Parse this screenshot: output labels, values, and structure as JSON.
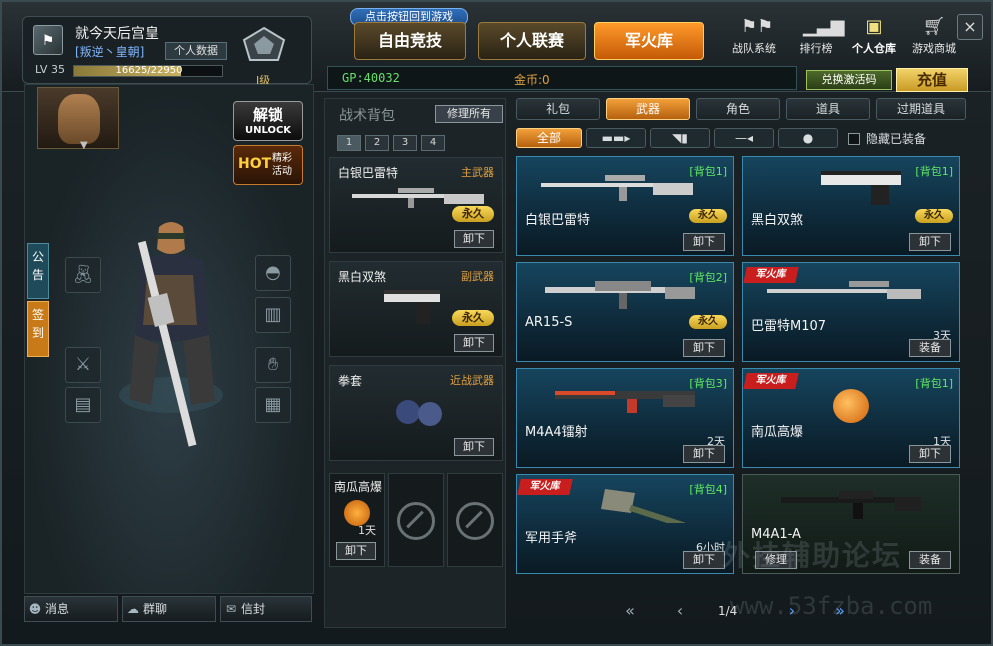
{
  "profile": {
    "name": "就今天后宫皇",
    "clan_tag": "[叛逆丶皇朝]",
    "personal_data": "个人数据",
    "level": "LV 35",
    "xp_text": "16625/22950",
    "xp_fraction": 0.724,
    "rank_label": "I级"
  },
  "top": {
    "home_tip": "点击按钮回到游戏",
    "tabs": [
      "自由竞技",
      "个人联赛",
      "军火库"
    ],
    "nav": [
      {
        "label": "战队系统",
        "icon": "flags-icon"
      },
      {
        "label": "排行榜",
        "icon": "bars-icon"
      },
      {
        "label": "个人仓库",
        "icon": "box-icon"
      },
      {
        "label": "游戏商城",
        "icon": "cart-icon"
      }
    ],
    "close": "×"
  },
  "currency": {
    "gp": "GP:40032",
    "coin": "金币:0",
    "redeem": "兑换激活码",
    "recharge": "充值"
  },
  "left": {
    "unlock_cn": "解锁",
    "unlock_en": "UNLOCK",
    "hot": "HOT",
    "event": "精彩活动",
    "notice": "公告",
    "sign": "签到",
    "bottom": [
      "消息",
      "群聊",
      "信封"
    ]
  },
  "backpack": {
    "title": "战术背包",
    "repair_all": "修理所有",
    "pages": [
      "1",
      "2",
      "3",
      "4"
    ],
    "slots": [
      {
        "name": "白银巴雷特",
        "type": "主武器",
        "perm": "永久",
        "unload": "卸下"
      },
      {
        "name": "黑白双煞",
        "type": "副武器",
        "perm": "永久",
        "unload": "卸下"
      },
      {
        "name": "拳套",
        "type": "近战武器",
        "unload": "卸下"
      }
    ],
    "grenade": {
      "name": "南瓜高爆",
      "days": "1天",
      "unload": "卸下"
    }
  },
  "inventory": {
    "categories": [
      "礼包",
      "武器",
      "角色",
      "道具",
      "过期道具"
    ],
    "active_category": 1,
    "sub_all": "全部",
    "hide_equipped": "隐藏已装备",
    "arsenal_tag": "军火库",
    "cards": [
      {
        "name": "白银巴雷特",
        "pack": "[背包1]",
        "perm": "永久",
        "btn": "卸下"
      },
      {
        "name": "黑白双煞",
        "pack": "[背包1]",
        "perm": "永久",
        "btn": "卸下"
      },
      {
        "name": "AR15-S",
        "pack": "[背包2]",
        "perm": "永久",
        "btn": "卸下"
      },
      {
        "name": "巴雷特M107",
        "days": "3天",
        "btn": "装备",
        "arsenal": true
      },
      {
        "name": "M4A4镭射",
        "pack": "[背包3]",
        "days": "2天",
        "btn": "卸下"
      },
      {
        "name": "南瓜高爆",
        "pack": "[背包1]",
        "days": "1天",
        "btn": "卸下",
        "arsenal": true
      },
      {
        "name": "军用手斧",
        "pack": "[背包4]",
        "days": "6小时",
        "btn": "卸下",
        "arsenal": true
      },
      {
        "name": "M4A1-A",
        "btn": "装备",
        "repair": "修理"
      }
    ],
    "page": "1/4"
  },
  "watermark": {
    "line1": "外挂辅助论坛",
    "line2": "www.53fzba.com"
  }
}
